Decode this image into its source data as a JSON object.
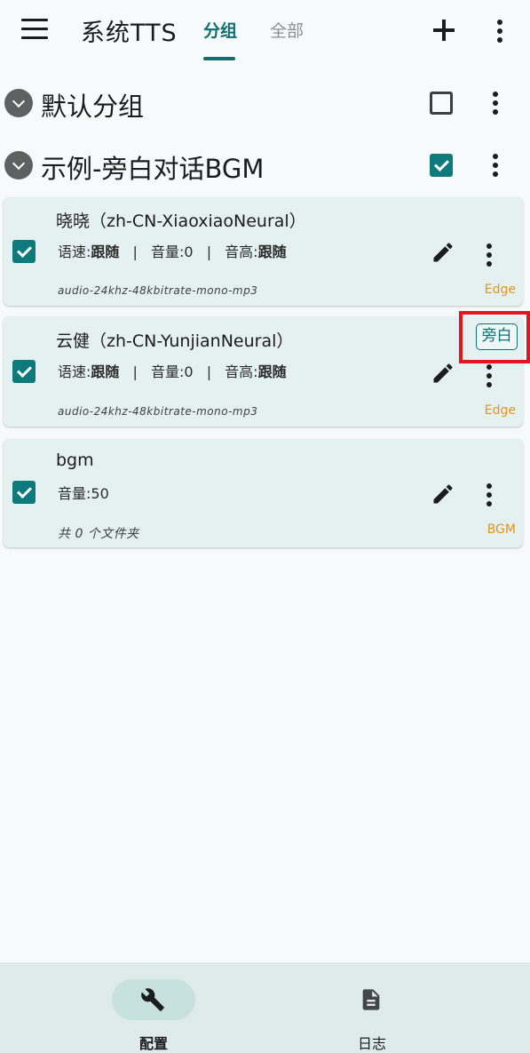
{
  "app": {
    "title": "系统TTS",
    "tabs": [
      {
        "label": "分组",
        "active": true
      },
      {
        "label": "全部",
        "active": false
      }
    ],
    "accent": "#0e6e70"
  },
  "groups": [
    {
      "name": "默认分组",
      "checked": false
    },
    {
      "name": "示例-旁白对话BGM",
      "checked": true
    }
  ],
  "items": [
    {
      "title": "晓晓（zh-CN-XiaoxiaoNeural）",
      "speed_label": "语速:",
      "speed_value": "跟随",
      "volume_label": "音量:",
      "volume_value": "0",
      "pitch_label": "音高:",
      "pitch_value": "跟随",
      "format": "audio-24khz-48kbitrate-mono-mp3",
      "type": "Edge",
      "checked": true
    },
    {
      "title": "云健（zh-CN-YunjianNeural）",
      "speed_label": "语速:",
      "speed_value": "跟随",
      "volume_label": "音量:",
      "volume_value": "0",
      "pitch_label": "音高:",
      "pitch_value": "跟随",
      "format": "audio-24khz-48kbitrate-mono-mp3",
      "type": "Edge",
      "tag": "旁白",
      "checked": true
    },
    {
      "title": "bgm",
      "volume_text": "音量:50",
      "format": "共 0 个文件夹",
      "type": "BGM",
      "checked": true
    }
  ],
  "separator": "|",
  "bottom_nav": [
    {
      "label": "配置",
      "icon": "wrench-icon",
      "active": true
    },
    {
      "label": "日志",
      "icon": "document-icon",
      "active": false
    }
  ],
  "colors": {
    "type_label": "#e0961c",
    "highlight": "#e8141c",
    "card_bg": "#e5f0f0"
  }
}
